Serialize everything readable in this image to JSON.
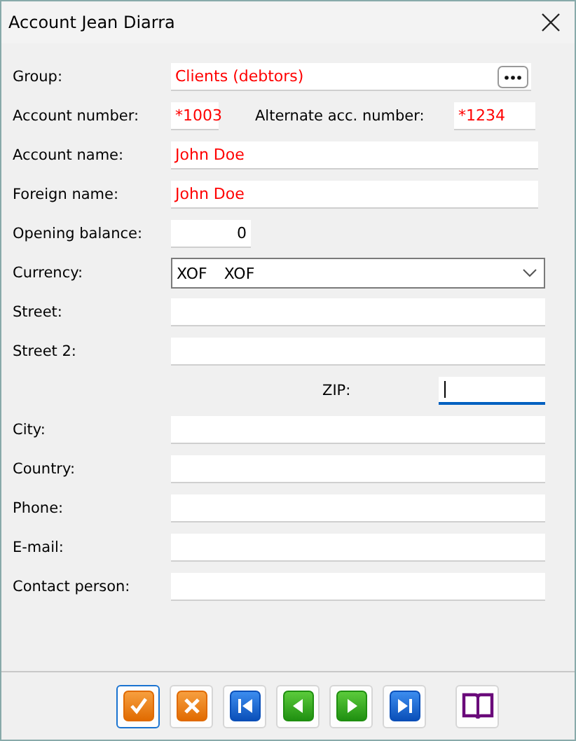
{
  "window": {
    "title": "Account Jean Diarra"
  },
  "rows": [
    {
      "kind": "picker",
      "label": "Group:",
      "value": "Clients (debtors)",
      "required": true
    },
    {
      "kind": "pair",
      "label": "Account number:",
      "value": "*1003",
      "required": true,
      "label_2": "Alternate acc. number:",
      "value_2": "*1234",
      "required_2": true
    },
    {
      "kind": "text",
      "label": "Account name:",
      "value": "John Doe",
      "required": true
    },
    {
      "kind": "text",
      "label": "Foreign name:",
      "value": "John Doe",
      "required": true
    },
    {
      "kind": "number",
      "label": "Opening balance:",
      "value": "0",
      "required": false
    },
    {
      "kind": "select",
      "label": "Currency:",
      "value": "XOF",
      "value_2": "XOF"
    },
    {
      "kind": "text",
      "label": "Street:"
    },
    {
      "kind": "text",
      "label": "Street 2:"
    },
    {
      "kind": "zip",
      "label": "ZIP:",
      "focused": true
    },
    {
      "kind": "text",
      "label": "City:"
    },
    {
      "kind": "text",
      "label": "Country:"
    },
    {
      "kind": "text",
      "label": "Phone:"
    },
    {
      "kind": "text",
      "label": "E-mail:"
    },
    {
      "kind": "text",
      "label": "Contact person:"
    }
  ],
  "toolbar": [
    {
      "kind": "confirm",
      "focused": true
    },
    {
      "kind": "cancel",
      "focused": false
    },
    {
      "kind": "first",
      "focused": false
    },
    {
      "kind": "previous",
      "focused": false
    },
    {
      "kind": "next",
      "focused": false
    },
    {
      "kind": "last",
      "focused": false
    },
    {
      "kind": "help",
      "focused": false
    }
  ]
}
